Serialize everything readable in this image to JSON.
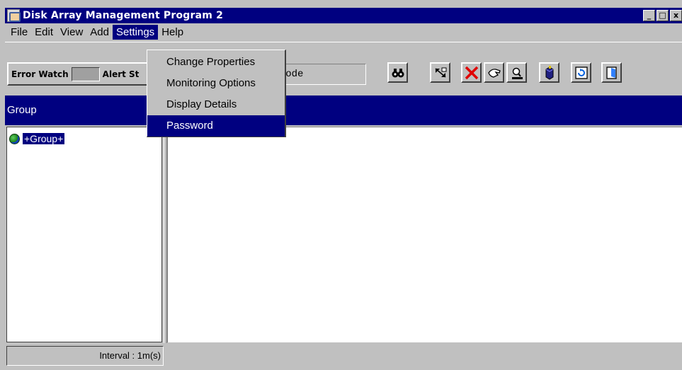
{
  "window": {
    "title": "Disk Array Management Program 2",
    "controls": [
      "_",
      "□",
      "x"
    ]
  },
  "menubar": {
    "items": [
      {
        "label": "File"
      },
      {
        "label": "Edit"
      },
      {
        "label": "View"
      },
      {
        "label": "Add"
      },
      {
        "label": "Settings",
        "active": true
      },
      {
        "label": "Help"
      }
    ]
  },
  "toolbar": {
    "error_watch": "Error Watch",
    "alert_st": "Alert St",
    "mode_text": "l Mode",
    "buttons": [
      {
        "name": "binoculars-icon"
      },
      {
        "name": "expand-icon"
      },
      {
        "name": "delete-x-icon",
        "color": "#e00000"
      },
      {
        "name": "hand-icon"
      },
      {
        "name": "inspect-icon"
      },
      {
        "name": "box-icon"
      },
      {
        "name": "refresh-icon"
      },
      {
        "name": "exit-door-icon"
      }
    ]
  },
  "left_panel": {
    "header": "Group",
    "tree_root": "+Group+"
  },
  "status_bar": {
    "interval": "Interval : 1m(s)"
  },
  "settings_menu": {
    "items": [
      {
        "label": "Change Properties"
      },
      {
        "label": "Monitoring Options"
      },
      {
        "label": "Display Details"
      },
      {
        "label": "Password",
        "highlighted": true
      }
    ]
  },
  "colors": {
    "title_bar": "#000080",
    "highlight": "#000080",
    "window_bg": "#c0c0c0"
  }
}
